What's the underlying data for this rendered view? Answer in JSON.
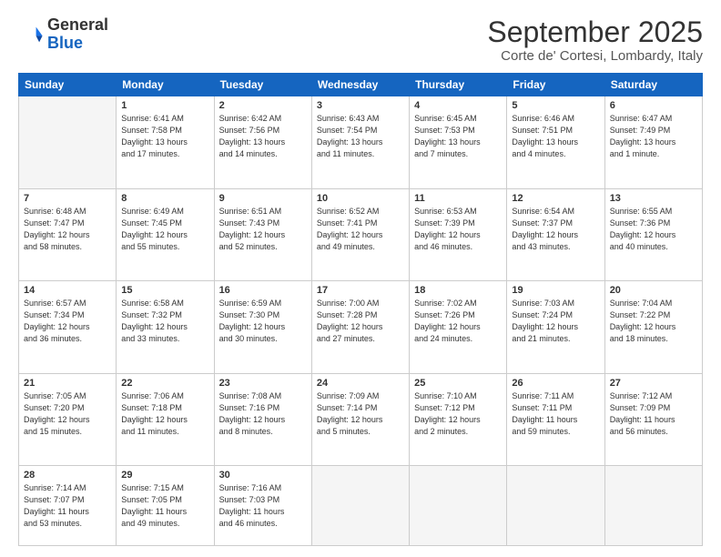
{
  "logo": {
    "line1": "General",
    "line2": "Blue"
  },
  "title": "September 2025",
  "subtitle": "Corte de' Cortesi, Lombardy, Italy",
  "days_of_week": [
    "Sunday",
    "Monday",
    "Tuesday",
    "Wednesday",
    "Thursday",
    "Friday",
    "Saturday"
  ],
  "weeks": [
    [
      {
        "day": "",
        "info": ""
      },
      {
        "day": "1",
        "info": "Sunrise: 6:41 AM\nSunset: 7:58 PM\nDaylight: 13 hours\nand 17 minutes."
      },
      {
        "day": "2",
        "info": "Sunrise: 6:42 AM\nSunset: 7:56 PM\nDaylight: 13 hours\nand 14 minutes."
      },
      {
        "day": "3",
        "info": "Sunrise: 6:43 AM\nSunset: 7:54 PM\nDaylight: 13 hours\nand 11 minutes."
      },
      {
        "day": "4",
        "info": "Sunrise: 6:45 AM\nSunset: 7:53 PM\nDaylight: 13 hours\nand 7 minutes."
      },
      {
        "day": "5",
        "info": "Sunrise: 6:46 AM\nSunset: 7:51 PM\nDaylight: 13 hours\nand 4 minutes."
      },
      {
        "day": "6",
        "info": "Sunrise: 6:47 AM\nSunset: 7:49 PM\nDaylight: 13 hours\nand 1 minute."
      }
    ],
    [
      {
        "day": "7",
        "info": "Sunrise: 6:48 AM\nSunset: 7:47 PM\nDaylight: 12 hours\nand 58 minutes."
      },
      {
        "day": "8",
        "info": "Sunrise: 6:49 AM\nSunset: 7:45 PM\nDaylight: 12 hours\nand 55 minutes."
      },
      {
        "day": "9",
        "info": "Sunrise: 6:51 AM\nSunset: 7:43 PM\nDaylight: 12 hours\nand 52 minutes."
      },
      {
        "day": "10",
        "info": "Sunrise: 6:52 AM\nSunset: 7:41 PM\nDaylight: 12 hours\nand 49 minutes."
      },
      {
        "day": "11",
        "info": "Sunrise: 6:53 AM\nSunset: 7:39 PM\nDaylight: 12 hours\nand 46 minutes."
      },
      {
        "day": "12",
        "info": "Sunrise: 6:54 AM\nSunset: 7:37 PM\nDaylight: 12 hours\nand 43 minutes."
      },
      {
        "day": "13",
        "info": "Sunrise: 6:55 AM\nSunset: 7:36 PM\nDaylight: 12 hours\nand 40 minutes."
      }
    ],
    [
      {
        "day": "14",
        "info": "Sunrise: 6:57 AM\nSunset: 7:34 PM\nDaylight: 12 hours\nand 36 minutes."
      },
      {
        "day": "15",
        "info": "Sunrise: 6:58 AM\nSunset: 7:32 PM\nDaylight: 12 hours\nand 33 minutes."
      },
      {
        "day": "16",
        "info": "Sunrise: 6:59 AM\nSunset: 7:30 PM\nDaylight: 12 hours\nand 30 minutes."
      },
      {
        "day": "17",
        "info": "Sunrise: 7:00 AM\nSunset: 7:28 PM\nDaylight: 12 hours\nand 27 minutes."
      },
      {
        "day": "18",
        "info": "Sunrise: 7:02 AM\nSunset: 7:26 PM\nDaylight: 12 hours\nand 24 minutes."
      },
      {
        "day": "19",
        "info": "Sunrise: 7:03 AM\nSunset: 7:24 PM\nDaylight: 12 hours\nand 21 minutes."
      },
      {
        "day": "20",
        "info": "Sunrise: 7:04 AM\nSunset: 7:22 PM\nDaylight: 12 hours\nand 18 minutes."
      }
    ],
    [
      {
        "day": "21",
        "info": "Sunrise: 7:05 AM\nSunset: 7:20 PM\nDaylight: 12 hours\nand 15 minutes."
      },
      {
        "day": "22",
        "info": "Sunrise: 7:06 AM\nSunset: 7:18 PM\nDaylight: 12 hours\nand 11 minutes."
      },
      {
        "day": "23",
        "info": "Sunrise: 7:08 AM\nSunset: 7:16 PM\nDaylight: 12 hours\nand 8 minutes."
      },
      {
        "day": "24",
        "info": "Sunrise: 7:09 AM\nSunset: 7:14 PM\nDaylight: 12 hours\nand 5 minutes."
      },
      {
        "day": "25",
        "info": "Sunrise: 7:10 AM\nSunset: 7:12 PM\nDaylight: 12 hours\nand 2 minutes."
      },
      {
        "day": "26",
        "info": "Sunrise: 7:11 AM\nSunset: 7:11 PM\nDaylight: 11 hours\nand 59 minutes."
      },
      {
        "day": "27",
        "info": "Sunrise: 7:12 AM\nSunset: 7:09 PM\nDaylight: 11 hours\nand 56 minutes."
      }
    ],
    [
      {
        "day": "28",
        "info": "Sunrise: 7:14 AM\nSunset: 7:07 PM\nDaylight: 11 hours\nand 53 minutes."
      },
      {
        "day": "29",
        "info": "Sunrise: 7:15 AM\nSunset: 7:05 PM\nDaylight: 11 hours\nand 49 minutes."
      },
      {
        "day": "30",
        "info": "Sunrise: 7:16 AM\nSunset: 7:03 PM\nDaylight: 11 hours\nand 46 minutes."
      },
      {
        "day": "",
        "info": ""
      },
      {
        "day": "",
        "info": ""
      },
      {
        "day": "",
        "info": ""
      },
      {
        "day": "",
        "info": ""
      }
    ]
  ]
}
